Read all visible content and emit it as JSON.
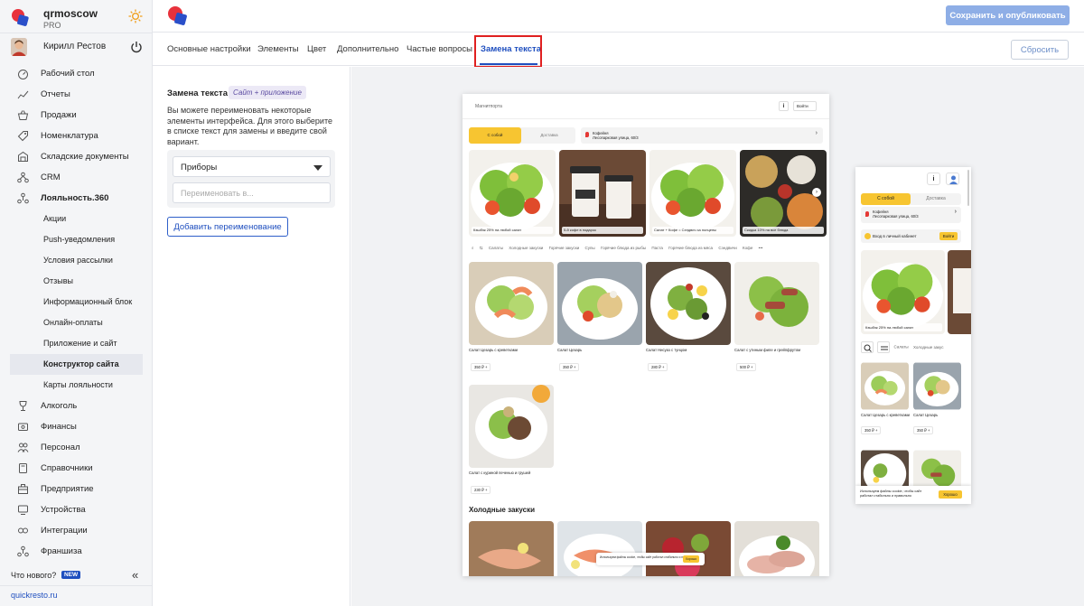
{
  "brand": {
    "name": "qrmoscow",
    "plan": "PRO"
  },
  "user": {
    "name": "Кирилл Рестов"
  },
  "sidebar": {
    "items": [
      {
        "label": "Рабочий стол",
        "icon": "dashboard-icon",
        "sub": false
      },
      {
        "label": "Отчеты",
        "icon": "reports-icon",
        "sub": false
      },
      {
        "label": "Продажи",
        "icon": "basket-icon",
        "sub": false
      },
      {
        "label": "Номенклатура",
        "icon": "tag-icon",
        "sub": false
      },
      {
        "label": "Складские документы",
        "icon": "warehouse-icon",
        "sub": false
      },
      {
        "label": "CRM",
        "icon": "crm-icon",
        "sub": false
      },
      {
        "label": "Лояльность.360",
        "icon": "loyalty-icon",
        "sub": false,
        "bold": true
      },
      {
        "label": "Акции",
        "sub": true
      },
      {
        "label": "Push-уведомления",
        "sub": true
      },
      {
        "label": "Условия рассылки",
        "sub": true
      },
      {
        "label": "Отзывы",
        "sub": true
      },
      {
        "label": "Информационный блок",
        "sub": true
      },
      {
        "label": "Онлайн-оплаты",
        "sub": true
      },
      {
        "label": "Приложение и сайт",
        "sub": true
      },
      {
        "label": "Конструктор сайта",
        "sub": true,
        "active": true
      },
      {
        "label": "Карты лояльности",
        "sub": true
      },
      {
        "label": "Алкоголь",
        "icon": "wine-glass-icon",
        "sub": false
      },
      {
        "label": "Финансы",
        "icon": "finance-icon",
        "sub": false
      },
      {
        "label": "Персонал",
        "icon": "staff-icon",
        "sub": false
      },
      {
        "label": "Справочники",
        "icon": "book-icon",
        "sub": false
      },
      {
        "label": "Предприятие",
        "icon": "enterprise-icon",
        "sub": false
      },
      {
        "label": "Устройства",
        "icon": "devices-icon",
        "sub": false
      },
      {
        "label": "Интеграции",
        "icon": "integrations-icon",
        "sub": false
      },
      {
        "label": "Франшиза",
        "icon": "franchise-icon",
        "sub": false
      }
    ],
    "whats_new": "Что нового?",
    "new_badge": "NEW",
    "site_link": "quickresto.ru"
  },
  "topbar": {
    "publish_label": "Сохранить и опубликовать"
  },
  "tabs": {
    "items": [
      "Основные настройки",
      "Элементы",
      "Цвет",
      "Дополнительно",
      "Частые вопросы",
      "Замена текста"
    ],
    "active_index": 5,
    "reset_label": "Сбросить"
  },
  "panel": {
    "title": "Замена текста",
    "badge": "Сайт + приложение",
    "description": "Вы можете переименовать некоторые элементы интерфейса. Для этого выберите в списке текст для замены и введите свой вариант.",
    "select_value": "Приборы",
    "rename_placeholder": "Переименовать в...",
    "add_label": "Добавить переименование"
  },
  "preview_desktop": {
    "brand": "Магнитпорта",
    "login": "Войти",
    "seg_on": "С собой",
    "seg_off": "Доставка",
    "addr_line1": "Кофейня",
    "addr_line2": "Лесопарковая улица, 60/3",
    "banners": [
      "Кэшбэк 25% на любой салат",
      "5-й кофе в подарок",
      "Салат + Кофе = Сэндвич за полцены",
      "Скидка 10% на все блюда"
    ],
    "categories": [
      "Салаты",
      "Холодные закуски",
      "Горячие закуски",
      "Супы",
      "Горячие блюда из рыбы",
      "Паста",
      "Горячие блюда из мяса",
      "Сэндвичи",
      "Кофе",
      "•••"
    ],
    "products": [
      {
        "name": "Салат Цезарь с креветками",
        "price": "350 ₽"
      },
      {
        "name": "Салат Цезарь",
        "price": "350 ₽"
      },
      {
        "name": "Салат Нисуаз с тунцом",
        "price": "280 ₽"
      },
      {
        "name": "Салат с утиным филе и грейпфрутом",
        "price": "500 ₽"
      },
      {
        "name": "Салат с куриной печенью и грушей",
        "price": "230 ₽"
      }
    ],
    "section_title": "Холодные закуски",
    "cookie_text": "Используем файлы cookie, чтобы сайт работал стабильно и правильно",
    "cookie_ok": "Хорошо"
  },
  "preview_mobile": {
    "seg_on": "С собой",
    "seg_off": "Доставка",
    "addr_line1": "Кофейня",
    "addr_line2": "Лесопарковая улица, 60/3",
    "cabinet": "Вход в личный кабинет",
    "cabinet_btn": "Войти",
    "banner": "Кэшбэк 25% на любой салат",
    "categories": [
      "Салаты",
      "Холодные закус"
    ],
    "products": [
      {
        "name": "Салат Цезарь с креветками",
        "price": "350 ₽"
      },
      {
        "name": "Салат Цезарь",
        "price": "350 ₽"
      }
    ],
    "cookie_text_1": "Используем файлы cookie, чтобы сайт",
    "cookie_text_2": "работал стабильно и правильно",
    "cookie_ok": "Хорошо"
  },
  "colors": {
    "accent": "#1f4fbf",
    "publish": "#8eaee6",
    "highlight": "#e02020",
    "yellow": "#f7c531"
  }
}
